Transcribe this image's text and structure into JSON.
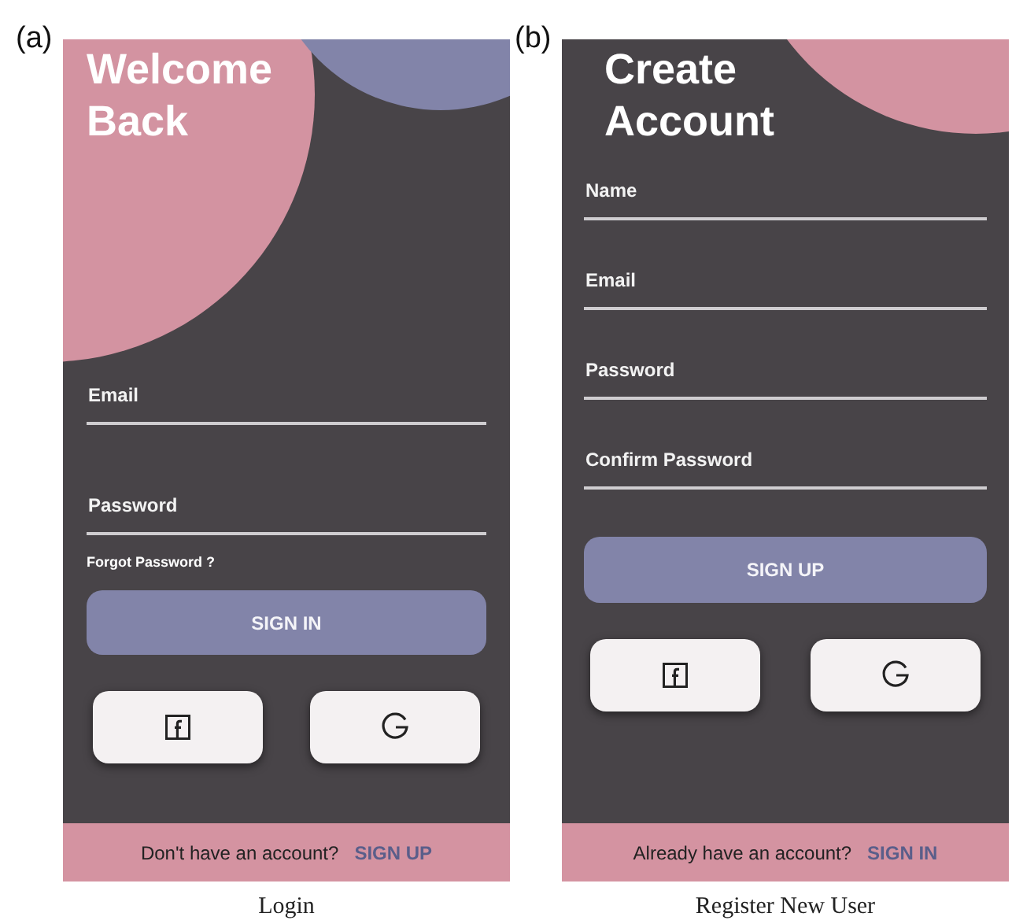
{
  "panels": [
    {
      "label": "(a)",
      "caption": "Login",
      "screen": {
        "kind": "login",
        "title": "Welcome Back",
        "fields": [
          {
            "placeholder": "Email"
          },
          {
            "placeholder": "Password"
          }
        ],
        "link": "Forgot Password ?",
        "primary_button": "SIGN IN",
        "social_buttons": [
          {
            "kind": "facebook"
          },
          {
            "kind": "google"
          }
        ],
        "footer": {
          "text": "Don't have an account?",
          "link": "SIGN UP"
        }
      }
    },
    {
      "label": "(b)",
      "caption": "Register New User",
      "screen": {
        "kind": "register",
        "title": "Create Account",
        "fields": [
          {
            "placeholder": "Name"
          },
          {
            "placeholder": "Email"
          },
          {
            "placeholder": "Password"
          },
          {
            "placeholder": "Confirm Password"
          }
        ],
        "primary_button": "SIGN UP",
        "social_buttons": [
          {
            "kind": "facebook"
          },
          {
            "kind": "google"
          }
        ],
        "footer": {
          "text": "Already have an account?",
          "link": "SIGN IN"
        }
      }
    }
  ]
}
